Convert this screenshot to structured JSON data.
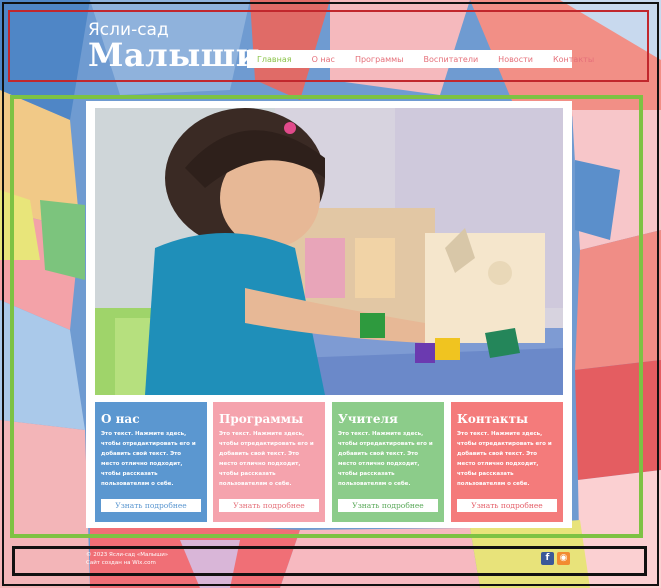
{
  "header": {
    "title_small": "Ясли-сад",
    "title_big": "Малыши",
    "nav": [
      "Главная",
      "О нас",
      "Программы",
      "Воспитатели",
      "Новости",
      "Контакты"
    ]
  },
  "cards": [
    {
      "title": "О нас",
      "text": "Это текст. Нажмите здесь, чтобы отредактировать его и добавить свой текст. Это место отлично подходит, чтобы рассказать пользователям о себе.",
      "button": "Узнать подробнее",
      "color": "#5b97d0",
      "btn_color": "#5b97d0"
    },
    {
      "title": "Программы",
      "text": "Это текст. Нажмите здесь, чтобы отредактировать его и добавить свой текст. Это место отлично подходит, чтобы рассказать пользователям о себе.",
      "button": "Узнать подробнее",
      "color": "#f5a3ad",
      "btn_color": "#e5707a"
    },
    {
      "title": "Учителя",
      "text": "Это текст. Нажмите здесь, чтобы отредактировать его и добавить свой текст. Это место отлично подходит, чтобы рассказать пользователям о себе.",
      "button": "Узнать подробнее",
      "color": "#8ccc8a",
      "btn_color": "#5aa95a"
    },
    {
      "title": "Контакты",
      "text": "Это текст. Нажмите здесь, чтобы отредактировать его и добавить свой текст. Это место отлично подходит, чтобы рассказать пользователям о себе.",
      "button": "Узнать подробнее",
      "color": "#f47b7b",
      "btn_color": "#e5606a"
    }
  ],
  "footer": {
    "copyright": "© 2023 Ясли-сад «Малыши»",
    "created": "Сайт создан на Wix.com"
  },
  "social": [
    {
      "icon": "facebook-icon",
      "glyph": "f",
      "color": "#3b5998"
    },
    {
      "icon": "rss-icon",
      "glyph": "◉",
      "color": "#f28b30"
    }
  ],
  "colors": {
    "nav_active": "#8bc34a",
    "nav_text": "#e5707a",
    "frame_header": "#c1272d",
    "frame_main": "#7dc243",
    "frame_footer": "#111111"
  }
}
